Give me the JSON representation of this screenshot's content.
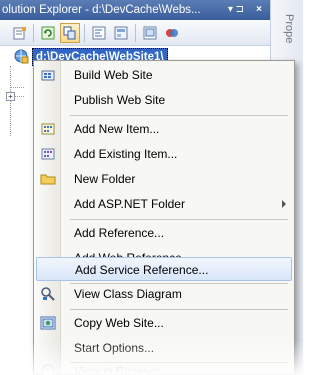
{
  "window": {
    "title": "olution Explorer - d:\\DevCache\\Webs...",
    "pin_glyph": "▾ ⊐",
    "close_glyph": "×",
    "side_tab": "Prope"
  },
  "tree": {
    "root_label": "d:\\DevCache\\WebSite1\\",
    "expander_glyph": "+"
  },
  "menu": {
    "items": [
      {
        "label": "Build Web Site",
        "icon": "build-icon"
      },
      {
        "label": "Publish Web Site",
        "icon": "none"
      },
      {
        "label": "Add New Item...",
        "icon": "add-new-item-icon"
      },
      {
        "label": "Add Existing Item...",
        "icon": "add-existing-item-icon"
      },
      {
        "label": "New Folder",
        "icon": "folder-icon"
      },
      {
        "label": "Add ASP.NET Folder",
        "icon": "none",
        "submenu": true
      },
      {
        "label": "Add Reference...",
        "icon": "none"
      },
      {
        "label": "Add Web Reference...",
        "icon": "none"
      },
      {
        "label": "Add Service Reference...",
        "icon": "none",
        "highlighted": true
      },
      {
        "label": "View Class Diagram",
        "icon": "class-diagram-icon"
      },
      {
        "label": "Copy Web Site...",
        "icon": "copy-web-site-icon"
      },
      {
        "label": "Start Options...",
        "icon": "none"
      },
      {
        "label": "View in Browser",
        "icon": "browser-icon"
      }
    ]
  },
  "colors": {
    "selection": "#3166c4",
    "hover_bg": "#d8e6fa",
    "hover_border": "#a9c4ea",
    "title_bar": "#3a5d9c"
  }
}
